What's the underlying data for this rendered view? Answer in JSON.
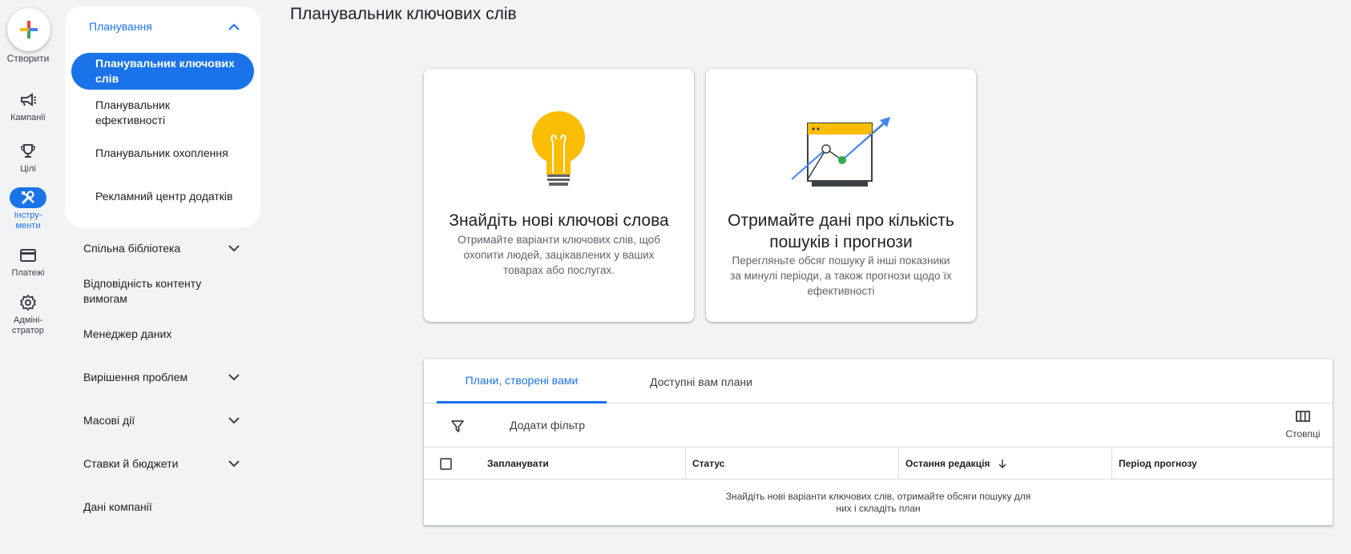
{
  "rail": {
    "create_label": "Створити",
    "items": [
      {
        "label": "Кампанії",
        "icon": "megaphone-icon"
      },
      {
        "label": "Цілі",
        "icon": "trophy-icon"
      },
      {
        "label": "Інстру-\nменти",
        "icon": "tools-icon"
      },
      {
        "label": "Платежі",
        "icon": "credit-card-icon"
      },
      {
        "label": "Адміні-\nстратор",
        "icon": "gear-icon"
      }
    ]
  },
  "nav": {
    "group_title": "Планування",
    "sub_items": [
      {
        "label": "Планувальник ключових слів"
      },
      {
        "label": "Планувальник ефективності"
      },
      {
        "label": "Планувальник охоплення"
      },
      {
        "label": "Рекламний центр додатків"
      }
    ],
    "items": [
      {
        "label": "Спільна бібліотека"
      },
      {
        "label": "Відповідність контенту вимогам"
      },
      {
        "label": "Менеджер даних"
      },
      {
        "label": "Вирішення проблем"
      },
      {
        "label": "Масові дії"
      },
      {
        "label": "Ставки й бюджети"
      },
      {
        "label": "Дані компанії"
      }
    ]
  },
  "main": {
    "title": "Планувальник ключових слів",
    "cards": [
      {
        "title": "Знайдіть нові ключові слова",
        "desc": "Отримайте варіанти ключових слів, щоб охопити людей, зацікавлених у ваших товарах або послугах."
      },
      {
        "title": "Отримайте дані про кількість пошуків і прогнози",
        "desc": "Перегляньте обсяг пошуку й інші показники за минулі періоди, а також прогнози щодо їх ефективності"
      }
    ],
    "tabs": [
      "Плани, створені вами",
      "Доступні вам плани"
    ],
    "add_filter": "Додати фільтр",
    "columns_label": "Стовпці",
    "headers": [
      "Запланувати",
      "Статус",
      "Остання редакція",
      "Період прогнозу"
    ],
    "empty_text": "Знайдіть нові варіанти ключових слів, отримайте обсяги пошуку для них і складіть план"
  },
  "colors": {
    "accent": "#1a73e8",
    "background": "#f1f3f4",
    "bulb": "#fbbc04",
    "green": "#34a853"
  }
}
